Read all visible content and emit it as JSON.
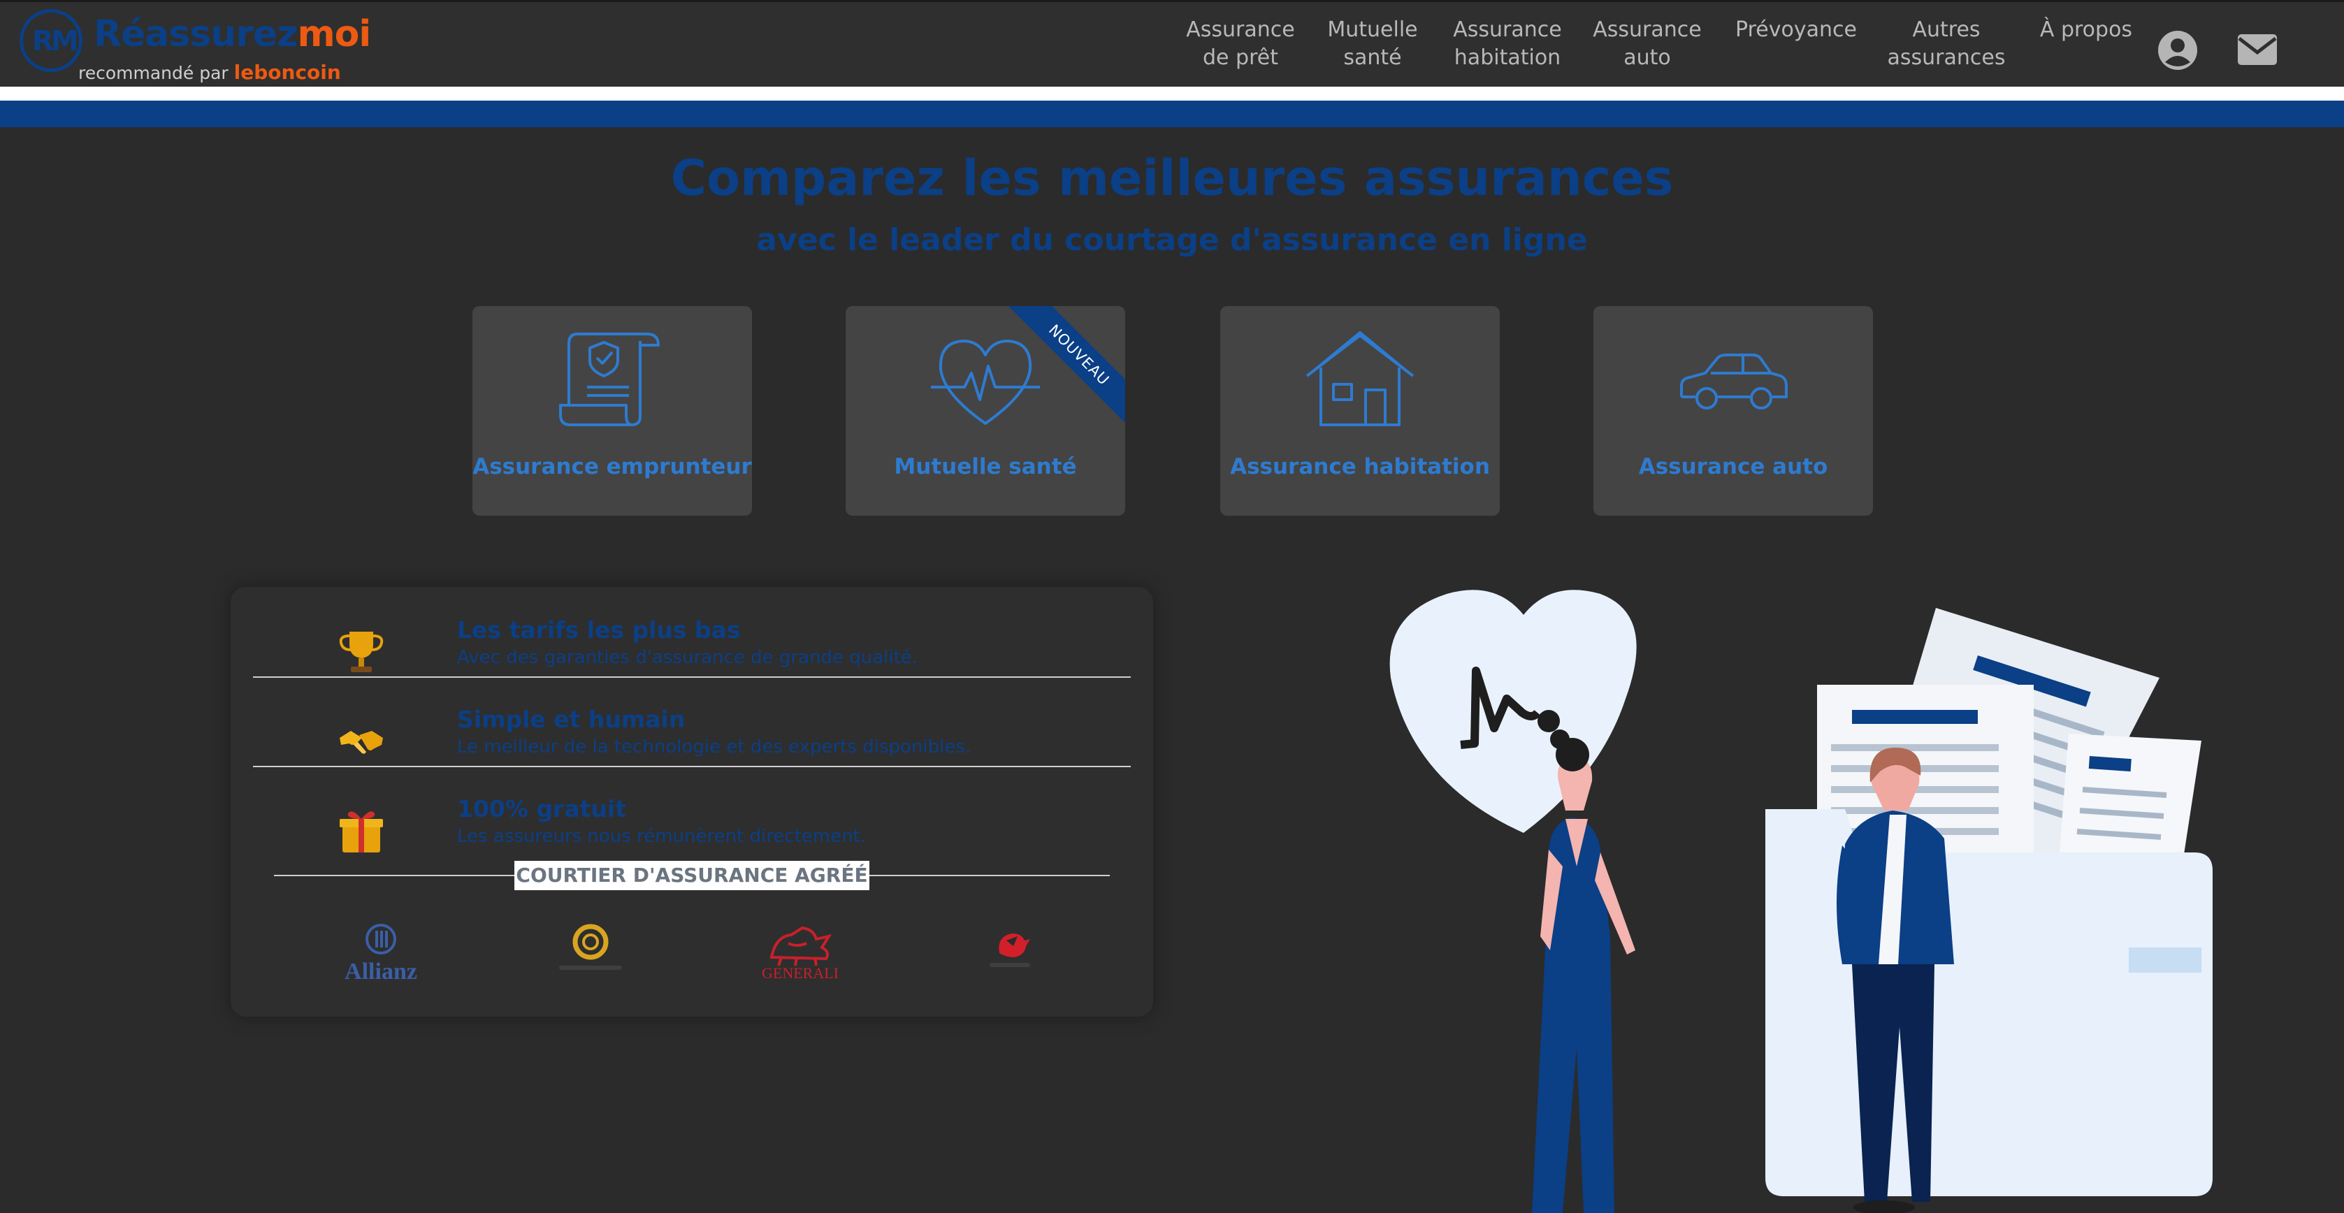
{
  "brand": {
    "name_main": "Réassurez",
    "name_accent": "moi",
    "monogram": "RM",
    "recommended_by": "recommandé par",
    "partner": "leboncoin",
    "color_primary": "#0b3f86",
    "color_accent": "#ec5a13"
  },
  "nav": {
    "items": [
      {
        "line1": "Assurance",
        "line2": "de prêt"
      },
      {
        "line1": "Mutuelle",
        "line2": "santé"
      },
      {
        "line1": "Assurance",
        "line2": "habitation"
      },
      {
        "line1": "Assurance",
        "line2": "auto"
      },
      {
        "line1": "Prévoyance",
        "line2": ""
      },
      {
        "line1": "Autres",
        "line2": "assurances"
      },
      {
        "line1": "À propos",
        "line2": ""
      }
    ],
    "account_icon": "user-circle-icon",
    "contact_icon": "envelope-icon"
  },
  "hero": {
    "title": "Comparez les meilleures assurances",
    "subtitle": "avec le leader du courtage d'assurance en ligne"
  },
  "products": [
    {
      "label": "Assurance emprunteur",
      "icon": "certificate-scroll-icon",
      "badge": ""
    },
    {
      "label": "Mutuelle santé",
      "icon": "heartbeat-icon",
      "badge": "NOUVEAU"
    },
    {
      "label": "Assurance habitation",
      "icon": "house-icon",
      "badge": ""
    },
    {
      "label": "Assurance auto",
      "icon": "car-icon",
      "badge": ""
    }
  ],
  "features": [
    {
      "icon": "trophy-icon",
      "title": "Les tarifs les plus bas",
      "description": "Avec des garanties d'assurance de grande qualité."
    },
    {
      "icon": "handshake-icon",
      "title": "Simple et humain",
      "description": "Le meilleur de la technologie et des experts disponibles."
    },
    {
      "icon": "gift-icon",
      "title": "100% gratuit",
      "description": "Les assureurs nous rémunèrent directement."
    }
  ],
  "broker": {
    "label": "COURTIER D'ASSURANCE AGRÉÉ"
  },
  "partners": [
    {
      "name": "Allianz",
      "icon": "allianz-logo-icon",
      "color": "#3a5fa8"
    },
    {
      "name": "",
      "icon": "gold-ring-logo-icon",
      "color": "#d9a520"
    },
    {
      "name": "GENERALI",
      "icon": "generali-lion-logo-icon",
      "color": "#c8202a"
    },
    {
      "name": "",
      "icon": "red-bird-logo-icon",
      "color": "#d21f2a"
    }
  ]
}
